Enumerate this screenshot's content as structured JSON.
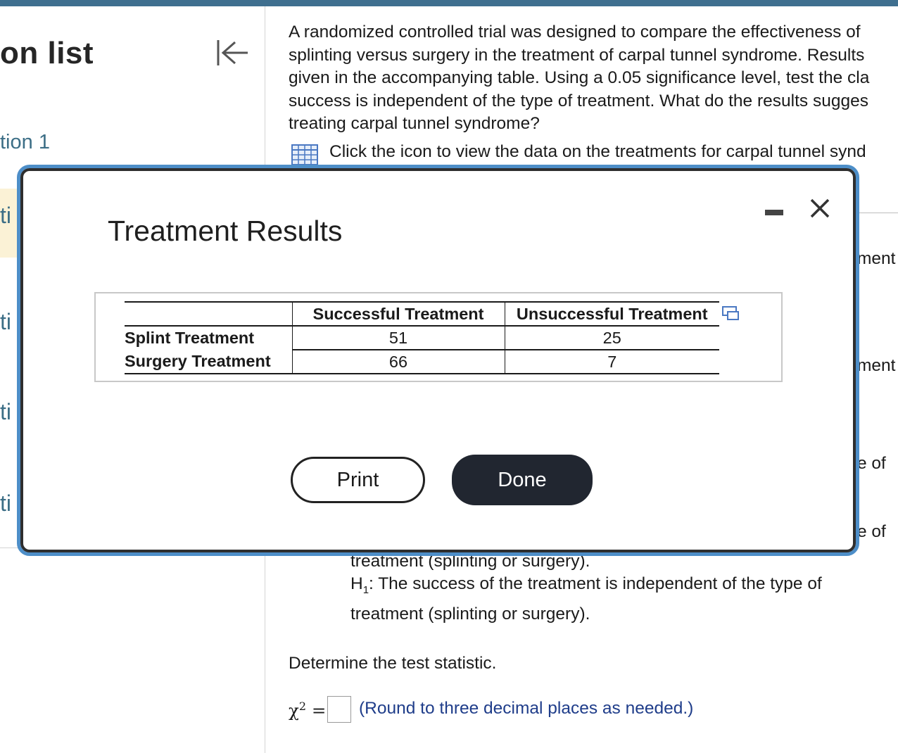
{
  "sidebar": {
    "title": "on list",
    "section": "tion 1",
    "items": [
      {
        "label": "ti"
      },
      {
        "label": "ti"
      },
      {
        "label": "ti"
      },
      {
        "label": "ti"
      }
    ]
  },
  "question": {
    "text": "A randomized controlled trial was designed to compare the effectiveness of\nsplinting versus surgery in the treatment of carpal tunnel syndrome. Results\ngiven in the accompanying table. Using a 0.05 significance level, test the cla\nsuccess is independent of the type of treatment. What do the results sugges\ntreating carpal tunnel syndrome?",
    "data_link": "Click the icon to view the data on the treatments for carpal tunnel synd",
    "peek": [
      "ment",
      "ment",
      "e of",
      "e of"
    ],
    "h0_fragment": "treatment (splinting or surgery).",
    "h1_label": "H",
    "h1_sub": "1",
    "h1_text": ": The success of the treatment is independent of the type of",
    "h1_cont": "treatment (splinting or surgery).",
    "determine": "Determine the test statistic.",
    "chi_symbol": "χ",
    "chi_sup": "2",
    "equals": "=",
    "round_hint": "(Round to three decimal places as needed.)"
  },
  "modal": {
    "title": "Treatment Results",
    "table": {
      "headers": [
        "",
        "Successful Treatment",
        "Unsuccessful Treatment"
      ],
      "rows": [
        [
          "Splint Treatment",
          "51",
          "25"
        ],
        [
          "Surgery Treatment",
          "66",
          "7"
        ]
      ]
    },
    "print_label": "Print",
    "done_label": "Done"
  },
  "colors": {
    "accent": "#3f6f8f",
    "modal_border": "#4d8ec8",
    "link_text": "#3c6e86",
    "hint_text": "#1f3d8a",
    "done_button": "#212630",
    "active_item": "#fbf2d6"
  },
  "icons": [
    "collapse-left-icon",
    "data-table-icon",
    "minimize-icon",
    "close-icon",
    "copy-icon"
  ]
}
